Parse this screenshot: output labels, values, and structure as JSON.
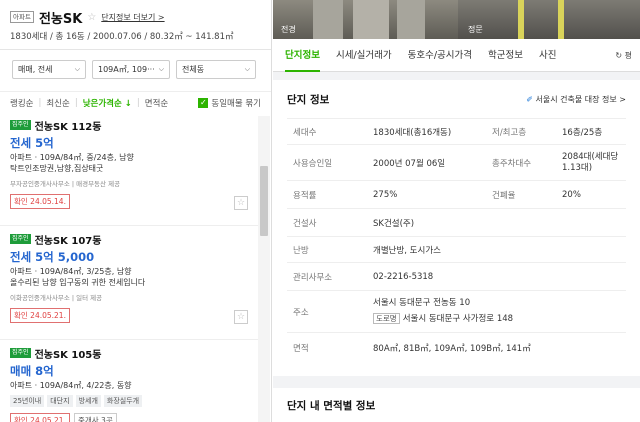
{
  "header": {
    "badge": "아파트",
    "title": "전농SK",
    "star": "☆",
    "more_link": "단지정보 더보기 >",
    "sub": "1830세대 / 총 16동 / 2000.07.06 / 80.32㎡ ~ 141.81㎡"
  },
  "filters": [
    {
      "label": "매매, 전세"
    },
    {
      "label": "109A㎡, 109···"
    },
    {
      "label": "전체동"
    }
  ],
  "sort": {
    "options": [
      "랭킹순",
      "최신순",
      "낮은가격순 ↓",
      "면적순"
    ],
    "active_index": 2,
    "same_listing_label": "동일매물 묶기",
    "same_listing_checked": true
  },
  "listings": [
    {
      "tag": "집주인",
      "name": "전농SK 112동",
      "price": "전세 5억",
      "spec": "아파트 · 109A/84㎡, 중/24층, 남향",
      "desc": "탁트인조망권,남향,집상태굿",
      "agent": "부자공인중개사사무소 | 매경부동산 제공",
      "confirm": "확인 24.05.14."
    },
    {
      "tag": "집주인",
      "name": "전농SK 107동",
      "price": "전세 5억 5,000",
      "spec": "아파트 · 109A/84㎡, 3/25층, 남향",
      "desc": "올수리된 남향 입구동의 귀한 전세입니다",
      "agent": "이화공인중개사사무소 | 일터 제공",
      "confirm": "확인 24.05.21."
    },
    {
      "tag": "집주인",
      "name": "전농SK 105동",
      "price": "매매 8억",
      "spec": "아파트 · 109A/84㎡, 4/22층, 동향",
      "chips": [
        "25년이내",
        "대단지",
        "방세개",
        "화장실두개"
      ],
      "confirm": "확인 24.05.21.",
      "agent_count": "중개사 3곳"
    }
  ],
  "photos": [
    {
      "label": "전경"
    },
    {
      "label": "정문"
    }
  ],
  "tabs": [
    {
      "label": "단지정보"
    },
    {
      "label": "시세/실거래가"
    },
    {
      "label": "동호수/공시가격"
    },
    {
      "label": "학군정보"
    },
    {
      "label": "사진"
    }
  ],
  "tabs_right": "↻ 평",
  "complex_info": {
    "title": "단지 정보",
    "link": "서울시 건축물 대장 정보 >",
    "rows": {
      "households_k": "세대수",
      "households_v": "1830세대(총16개동)",
      "floors_k": "저/최고층",
      "floors_v": "16층/25층",
      "approval_k": "사용승인일",
      "approval_v": "2000년 07월 06일",
      "parking_k": "총주차대수",
      "parking_v": "2084대(세대당 1.13대)",
      "far_k": "용적률",
      "far_v": "275%",
      "bcr_k": "건폐율",
      "bcr_v": "20%",
      "builder_k": "건설사",
      "builder_v": "SK건설(주)",
      "heating_k": "난방",
      "heating_v": "개별난방, 도시가스",
      "office_k": "관리사무소",
      "office_v": "02-2216-5318",
      "address_k": "주소",
      "address_v": "서울시 동대문구 전농동 10",
      "road_badge": "도로명",
      "road_v": "서울시 동대문구 사가정로 148",
      "area_k": "면적",
      "area_v": "80A㎡, 81B㎡, 109A㎡, 109B㎡, 141㎡"
    }
  },
  "area_section_title": "단지 내 면적별 정보"
}
